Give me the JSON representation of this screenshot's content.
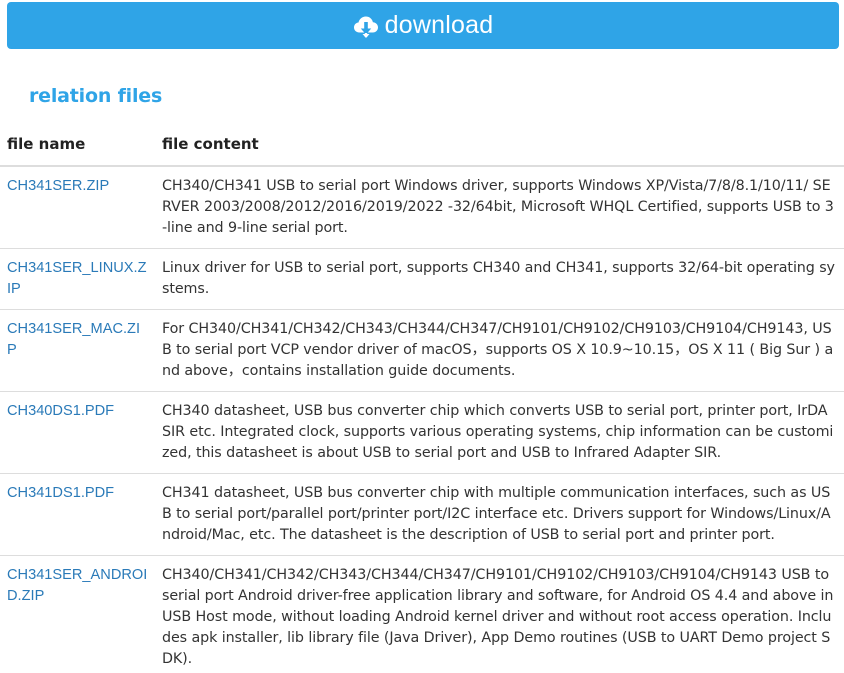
{
  "download_button": {
    "icon": "cloud-download-icon",
    "label": "download",
    "color": "#2fa4e7"
  },
  "section": {
    "title": "relation files",
    "title_color": "#2fa4e7"
  },
  "table": {
    "headers": {
      "file_name": "file name",
      "file_content": "file content"
    },
    "rows": [
      {
        "name": "CH341SER.ZIP",
        "content": "CH340/CH341 USB to serial port Windows driver, supports Windows XP/Vista/7/8/8.1/10/11/ SERVER 2003/2008/2012/2016/2019/2022 -32/64bit, Microsoft WHQL Certified, supports USB to 3-line and 9-line serial port."
      },
      {
        "name": "CH341SER_LINUX.ZIP",
        "content": "Linux driver for USB to serial port, supports CH340 and CH341, supports 32/64-bit operating systems."
      },
      {
        "name": "CH341SER_MAC.ZIP",
        "content": "For CH340/CH341/CH342/CH343/CH344/CH347/CH9101/CH9102/CH9103/CH9104/CH9143, USB to serial port VCP vendor driver of macOS，supports OS X 10.9~10.15，OS X 11 ( Big Sur ) and above，contains installation guide documents."
      },
      {
        "name": "CH340DS1.PDF",
        "content": "CH340 datasheet, USB bus converter chip which converts USB to serial port, printer port, IrDA SIR etc. Integrated clock, supports various operating systems, chip information can be customized, this datasheet is about USB to serial port and USB to Infrared Adapter SIR."
      },
      {
        "name": "CH341DS1.PDF",
        "content": "CH341 datasheet, USB bus converter chip with multiple communication interfaces, such as USB to serial port/parallel port/printer port/I2C interface etc. Drivers support for Windows/Linux/Android/Mac, etc. The datasheet is the description of USB to serial port and printer port."
      },
      {
        "name": "CH341SER_ANDROID.ZIP",
        "content": "CH340/CH341/CH342/CH343/CH344/CH347/CH9101/CH9102/CH9103/CH9104/CH9143 USB to serial port Android driver-free application library and software, for Android OS 4.4 and above in USB Host mode, without loading Android kernel driver and without root access operation. Includes apk installer, lib library file (Java Driver), App Demo routines (USB to UART Demo project SDK)."
      }
    ]
  }
}
